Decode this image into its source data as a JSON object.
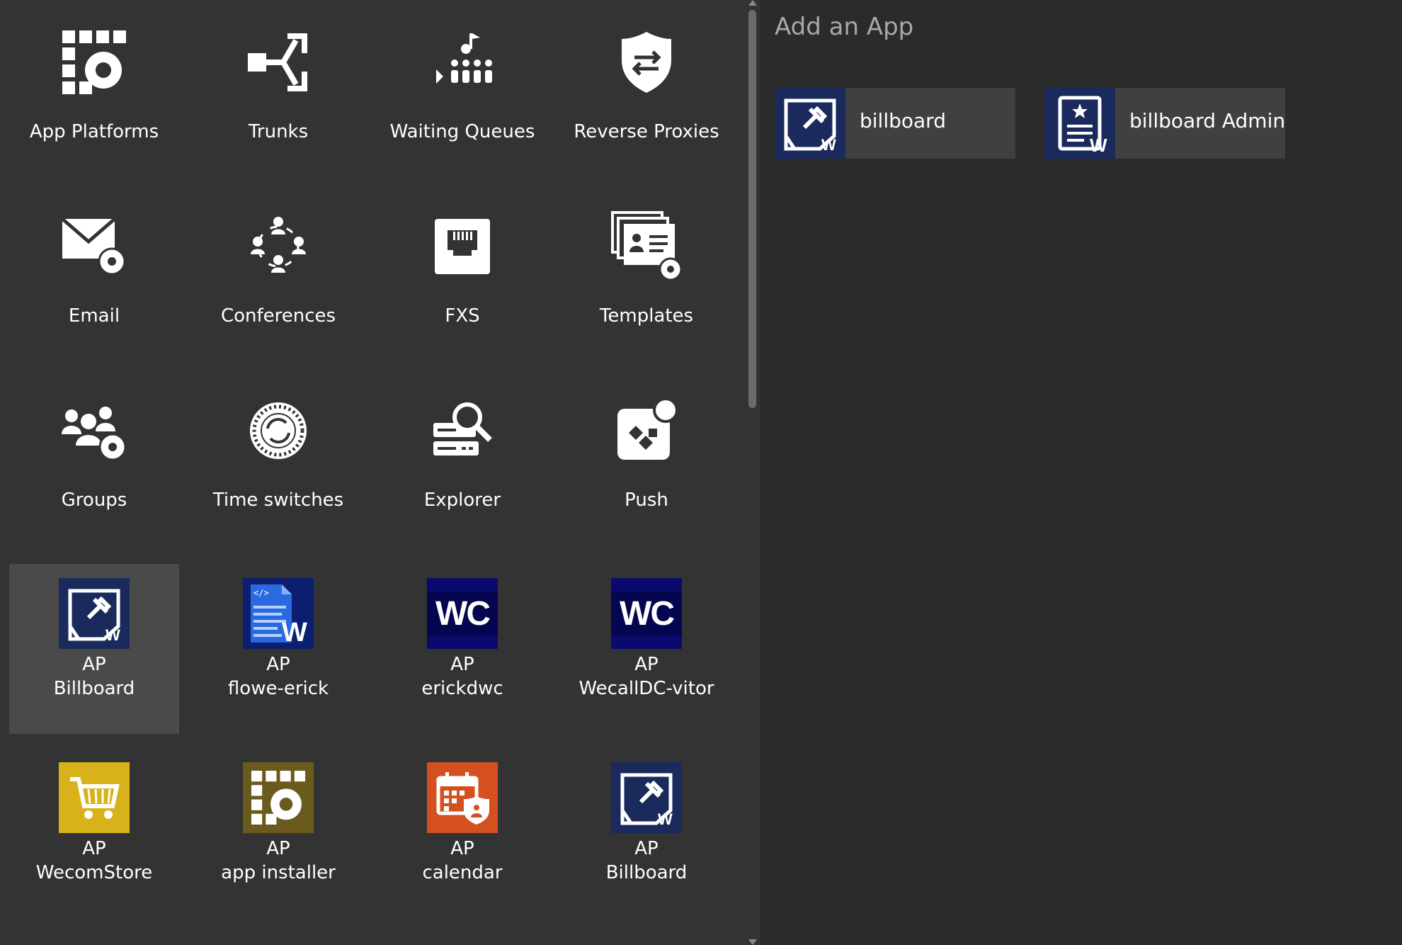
{
  "add_app": {
    "title": "Add an App",
    "apps": [
      {
        "label": "billboard",
        "icon": "billboard-icon"
      },
      {
        "label": "billboard Admin",
        "icon": "billboard-admin-icon"
      }
    ]
  },
  "tiles": [
    {
      "label": "App Platforms",
      "icon": "app-platforms-icon"
    },
    {
      "label": "Trunks",
      "icon": "trunks-icon"
    },
    {
      "label": "Waiting Queues",
      "icon": "waiting-queues-icon"
    },
    {
      "label": "Reverse Proxies",
      "icon": "reverse-proxies-icon"
    },
    {
      "label": "Email",
      "icon": "email-settings-icon"
    },
    {
      "label": "Conferences",
      "icon": "conferences-icon"
    },
    {
      "label": "FXS",
      "icon": "fxs-port-icon"
    },
    {
      "label": "Templates",
      "icon": "templates-icon"
    },
    {
      "label": "Groups",
      "icon": "groups-icon"
    },
    {
      "label": "Time switches",
      "icon": "time-switches-icon"
    },
    {
      "label": "Explorer",
      "icon": "explorer-icon"
    },
    {
      "label": "Push",
      "icon": "push-icon"
    }
  ],
  "ap_tiles": [
    {
      "prefix": "AP",
      "label": "Billboard",
      "icon": "billboard-icon",
      "color": "#1b2a5c",
      "selected": true
    },
    {
      "prefix": "AP",
      "label": "flowe-erick",
      "icon": "flowe-document-icon",
      "color": "#1e2f8a"
    },
    {
      "prefix": "AP",
      "label": "erickdwc",
      "icon": "wc-logo-icon",
      "color": "#0d0d6b"
    },
    {
      "prefix": "AP",
      "label": "WecallDC-vitor",
      "icon": "wc-logo-icon",
      "color": "#0d0d6b"
    },
    {
      "prefix": "AP",
      "label": "WecomStore",
      "icon": "shopping-cart-icon",
      "color": "#d8b21a"
    },
    {
      "prefix": "AP",
      "label": "app installer",
      "icon": "app-installer-icon",
      "color": "#6b5a1e"
    },
    {
      "prefix": "AP",
      "label": "calendar",
      "icon": "calendar-icon",
      "color": "#d4501e"
    },
    {
      "prefix": "AP",
      "label": "Billboard",
      "icon": "billboard-icon",
      "color": "#1b2a5c"
    }
  ]
}
